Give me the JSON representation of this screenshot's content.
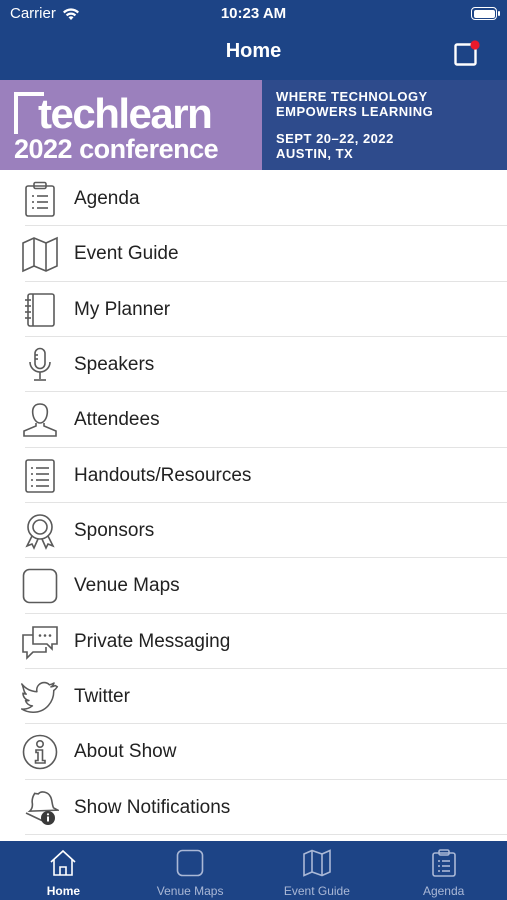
{
  "status_bar": {
    "carrier": "Carrier",
    "time": "10:23 AM"
  },
  "nav": {
    "title": "Home"
  },
  "banner": {
    "brand": "techlearn",
    "subtitle": "2022 conference",
    "tagline_1": "WHERE TECHNOLOGY",
    "tagline_2": "EMPOWERS LEARNING",
    "dates": "SEPT 20–22, 2022",
    "location": "AUSTIN, TX"
  },
  "menu": [
    {
      "label": "Agenda",
      "icon": "clipboard-icon"
    },
    {
      "label": "Event Guide",
      "icon": "map-icon"
    },
    {
      "label": "My Planner",
      "icon": "notebook-icon"
    },
    {
      "label": "Speakers",
      "icon": "microphone-icon"
    },
    {
      "label": "Attendees",
      "icon": "person-icon"
    },
    {
      "label": "Handouts/Resources",
      "icon": "document-list-icon"
    },
    {
      "label": "Sponsors",
      "icon": "award-ribbon-icon"
    },
    {
      "label": "Venue Maps",
      "icon": "square-icon"
    },
    {
      "label": "Private Messaging",
      "icon": "chat-bubbles-icon"
    },
    {
      "label": "Twitter",
      "icon": "twitter-bird-icon"
    },
    {
      "label": "About Show",
      "icon": "info-icon"
    },
    {
      "label": "Show Notifications",
      "icon": "bell-info-icon"
    }
  ],
  "tabs": [
    {
      "label": "Home",
      "icon": "home-icon",
      "active": true
    },
    {
      "label": "Venue Maps",
      "icon": "square-icon"
    },
    {
      "label": "Event Guide",
      "icon": "map-icon"
    },
    {
      "label": "Agenda",
      "icon": "clipboard-icon"
    }
  ],
  "colors": {
    "navy": "#1d4486",
    "purple": "#9b80bd",
    "notification_dot": "#e8192c"
  }
}
